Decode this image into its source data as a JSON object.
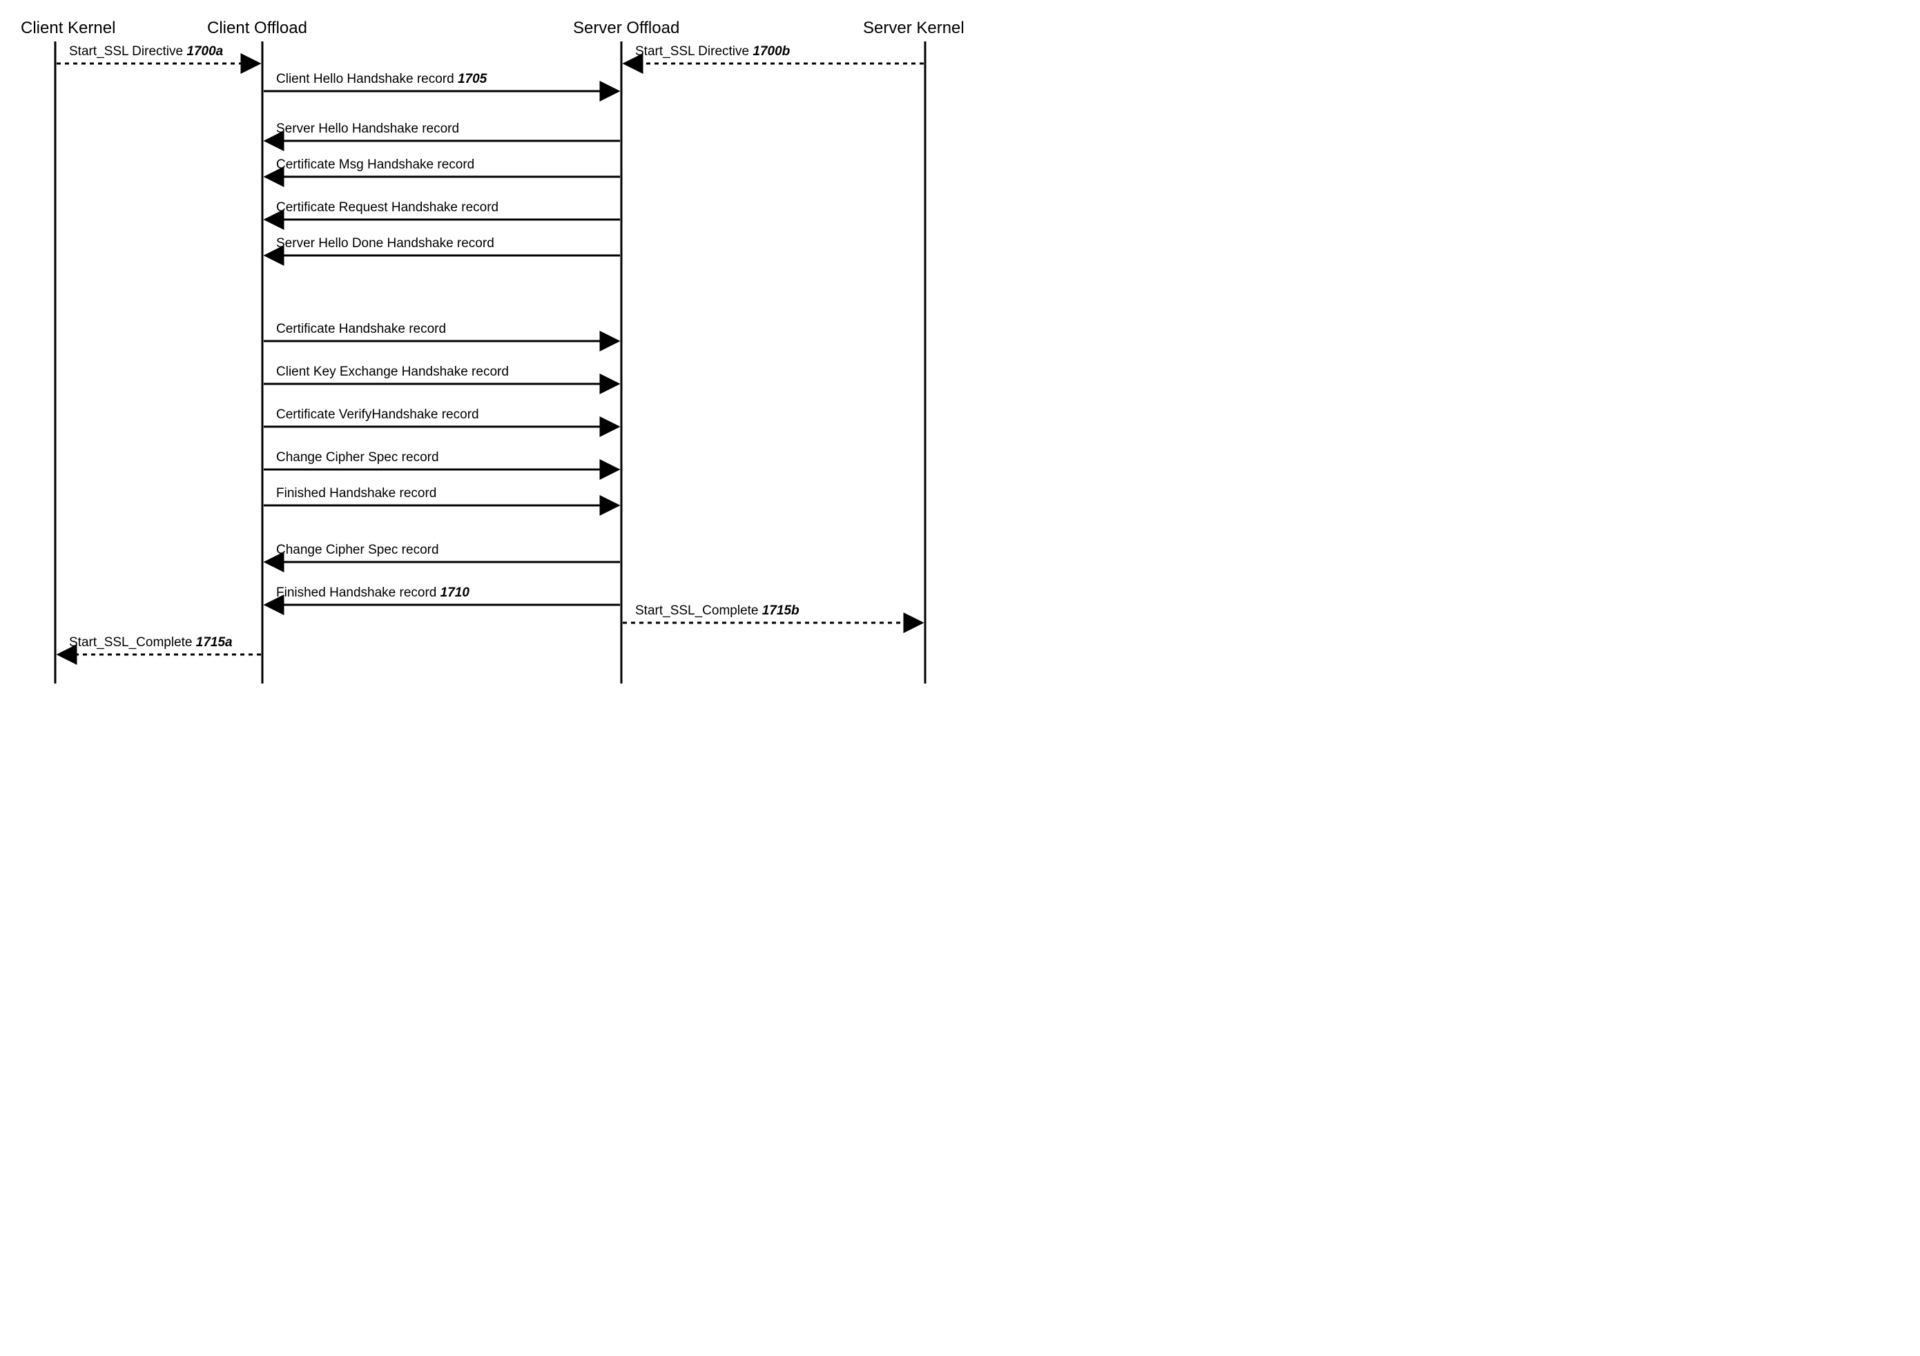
{
  "lifelines": {
    "clientKernel": "Client Kernel",
    "clientOffload": "Client Offload",
    "serverOffload": "Server Offload",
    "serverKernel": "Server Kernel"
  },
  "messages": {
    "startSSLa": {
      "text": "Start_SSL Directive ",
      "ref": "1700a"
    },
    "startSSLb": {
      "text": "Start_SSL Directive ",
      "ref": "1700b"
    },
    "clientHello": {
      "text": "Client Hello Handshake record  ",
      "ref": "1705"
    },
    "serverHello": "Server Hello Handshake record",
    "certMsg": "Certificate Msg Handshake record",
    "certReq": "Certificate Request Handshake record",
    "serverHelloDone": "Server Hello Done Handshake record",
    "cert": "Certificate Handshake record",
    "clientKeyEx": "Client Key Exchange Handshake record",
    "certVerify": "Certificate VerifyHandshake record",
    "ccs1": "Change Cipher Spec record",
    "finished1": "Finished Handshake record",
    "ccs2": "Change Cipher Spec record",
    "finished2": {
      "text": "Finished Handshake record  ",
      "ref": "1710"
    },
    "completeB": {
      "text": "Start_SSL_Complete ",
      "ref": "1715b"
    },
    "completeA": {
      "text": "Start_SSL_Complete ",
      "ref": "1715a"
    }
  },
  "chart_data": {
    "type": "sequence-diagram",
    "lifelines": [
      "Client Kernel",
      "Client Offload",
      "Server Offload",
      "Server Kernel"
    ],
    "messages": [
      {
        "from": "Client Kernel",
        "to": "Client Offload",
        "label": "Start_SSL Directive 1700a",
        "style": "dashed"
      },
      {
        "from": "Server Kernel",
        "to": "Server Offload",
        "label": "Start_SSL Directive 1700b",
        "style": "dashed"
      },
      {
        "from": "Client Offload",
        "to": "Server Offload",
        "label": "Client Hello Handshake record 1705",
        "style": "solid"
      },
      {
        "from": "Server Offload",
        "to": "Client Offload",
        "label": "Server Hello Handshake record",
        "style": "solid"
      },
      {
        "from": "Server Offload",
        "to": "Client Offload",
        "label": "Certificate Msg Handshake record",
        "style": "solid"
      },
      {
        "from": "Server Offload",
        "to": "Client Offload",
        "label": "Certificate Request Handshake record",
        "style": "solid"
      },
      {
        "from": "Server Offload",
        "to": "Client Offload",
        "label": "Server Hello Done Handshake record",
        "style": "solid"
      },
      {
        "from": "Client Offload",
        "to": "Server Offload",
        "label": "Certificate Handshake record",
        "style": "solid"
      },
      {
        "from": "Client Offload",
        "to": "Server Offload",
        "label": "Client Key Exchange Handshake record",
        "style": "solid"
      },
      {
        "from": "Client Offload",
        "to": "Server Offload",
        "label": "Certificate VerifyHandshake record",
        "style": "solid"
      },
      {
        "from": "Client Offload",
        "to": "Server Offload",
        "label": "Change Cipher Spec record",
        "style": "solid"
      },
      {
        "from": "Client Offload",
        "to": "Server Offload",
        "label": "Finished Handshake record",
        "style": "solid"
      },
      {
        "from": "Server Offload",
        "to": "Client Offload",
        "label": "Change Cipher Spec record",
        "style": "solid"
      },
      {
        "from": "Server Offload",
        "to": "Client Offload",
        "label": "Finished Handshake record 1710",
        "style": "solid"
      },
      {
        "from": "Server Offload",
        "to": "Server Kernel",
        "label": "Start_SSL_Complete 1715b",
        "style": "dashed"
      },
      {
        "from": "Client Offload",
        "to": "Client Kernel",
        "label": "Start_SSL_Complete 1715a",
        "style": "dashed"
      }
    ]
  }
}
